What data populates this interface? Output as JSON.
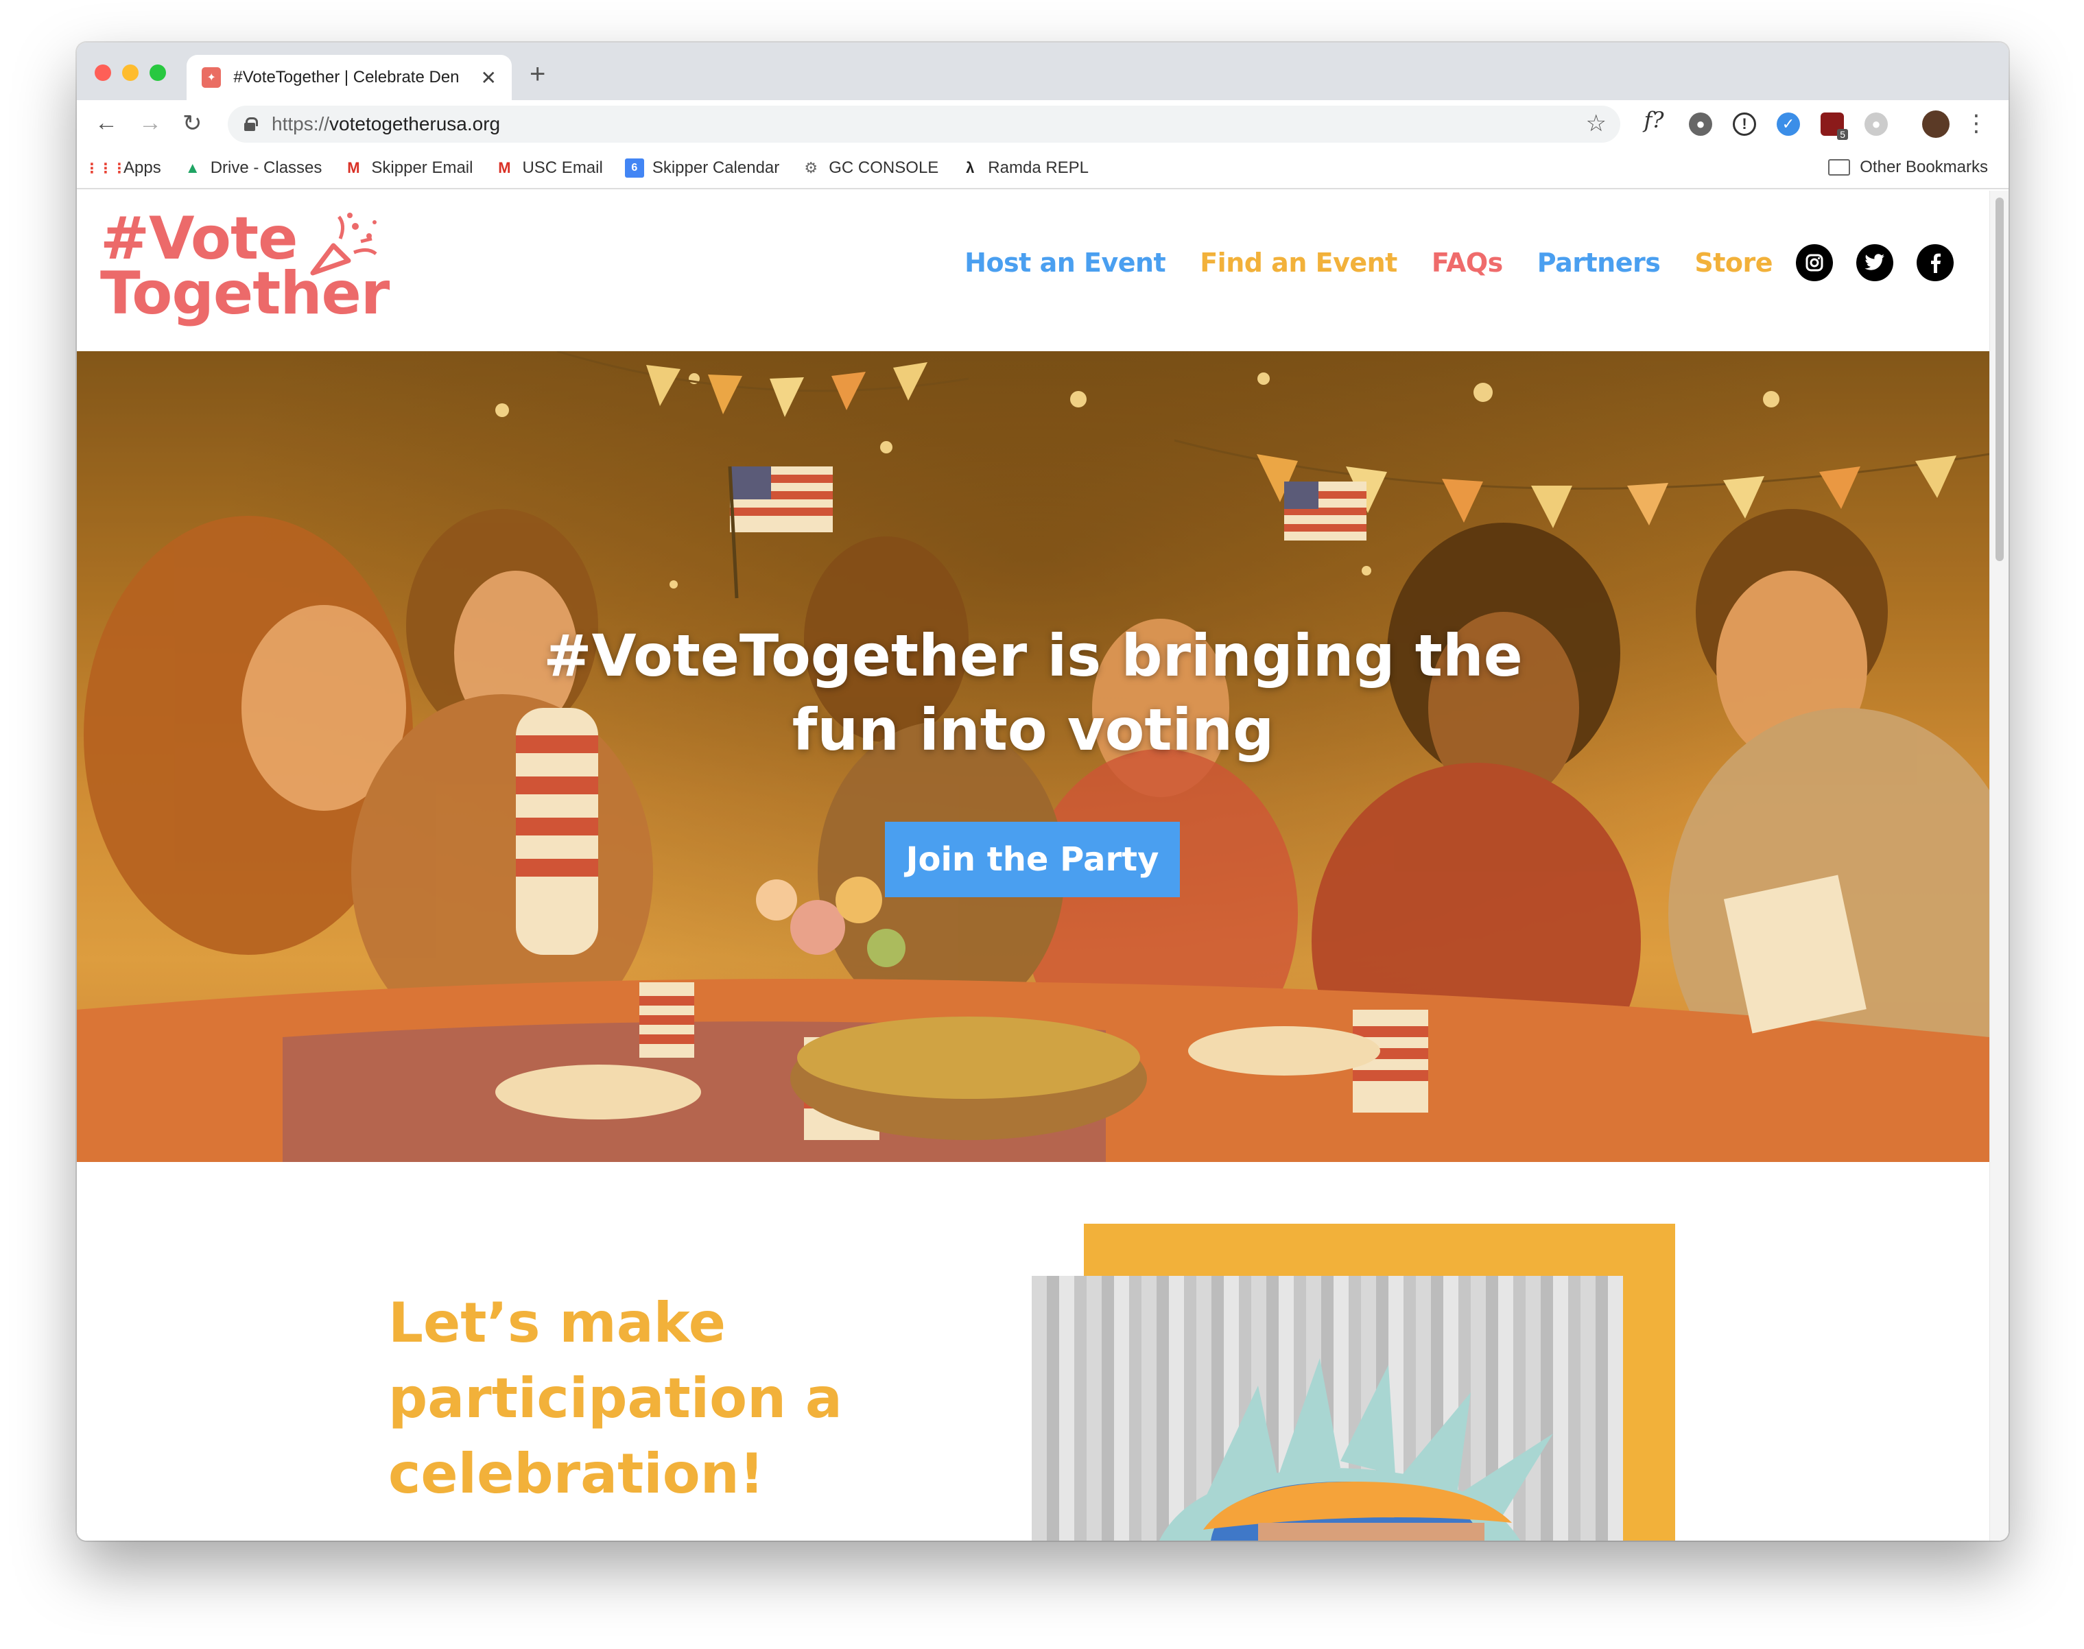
{
  "browser": {
    "tab": {
      "title": "#VoteTogether | Celebrate Den"
    },
    "url": {
      "scheme": "https://",
      "host": "votetogetherusa.org"
    },
    "bookmarks": [
      {
        "label": "Apps",
        "icon": "apps-grid-icon"
      },
      {
        "label": "Drive - Classes",
        "icon": "google-drive-icon"
      },
      {
        "label": "Skipper Email",
        "icon": "gmail-icon"
      },
      {
        "label": "USC Email",
        "icon": "gmail-icon"
      },
      {
        "label": "Skipper Calendar",
        "icon": "calendar-icon",
        "badge": "6"
      },
      {
        "label": "GC CONSOLE",
        "icon": "gear-icon"
      },
      {
        "label": "Ramda REPL",
        "icon": "lambda-icon"
      }
    ],
    "other_bookmarks": "Other Bookmarks",
    "extensions": [
      {
        "name": "function-icon",
        "text": "f?"
      },
      {
        "name": "extension-gray-icon"
      },
      {
        "name": "info-icon",
        "text": "!"
      },
      {
        "name": "extension-blue-icon"
      },
      {
        "name": "shield-extension-icon",
        "badge": "5"
      },
      {
        "name": "extension-light-icon"
      }
    ],
    "colors": {
      "tabstrip": "#dee1e6",
      "omnibox": "#f1f3f4"
    }
  },
  "site": {
    "logo": {
      "line1": "#Vote",
      "line2": "Together"
    },
    "nav": [
      {
        "label": "Host an Event",
        "color": "blue"
      },
      {
        "label": "Find an Event",
        "color": "orange"
      },
      {
        "label": "FAQs",
        "color": "coral"
      },
      {
        "label": "Partners",
        "color": "blue"
      },
      {
        "label": "Store",
        "color": "orange"
      }
    ],
    "social": [
      "instagram-icon",
      "twitter-icon",
      "facebook-icon"
    ],
    "hero": {
      "title_line1": "#VoteTogether is bringing the",
      "title_line2": "fun into voting",
      "cta": "Join the Party"
    },
    "section": {
      "heading_line1": "Let’s make",
      "heading_line2": "participation a",
      "heading_line3": "celebration!"
    },
    "colors": {
      "blue": "#4a9ff0",
      "orange": "#f2b13a",
      "coral": "#ef6b6b",
      "logo": "#ec6a6a"
    }
  }
}
